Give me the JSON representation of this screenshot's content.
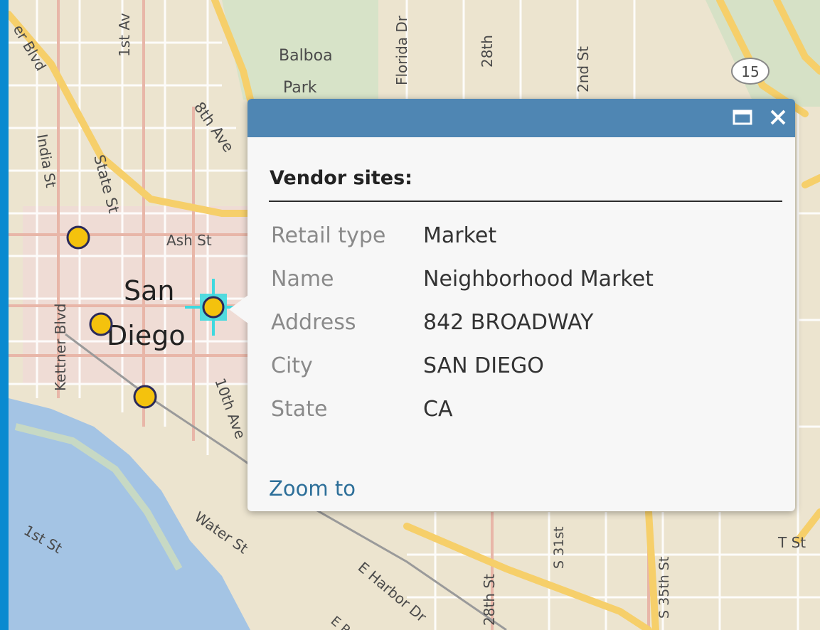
{
  "colors": {
    "frame_blue": "#0a8ad0",
    "header_blue": "#4f86b3",
    "marker_fill": "#f4c20d",
    "selection_cyan": "#3fd9df"
  },
  "popup": {
    "title": "Vendor sites:",
    "maximize_icon": "maximize-icon",
    "close_icon": "close-icon",
    "fields": [
      {
        "label": "Retail type",
        "value": "Market"
      },
      {
        "label": "Name",
        "value": "Neighborhood Market"
      },
      {
        "label": "Address",
        "value": "842 BROADWAY"
      },
      {
        "label": "City",
        "value": "SAN DIEGO"
      },
      {
        "label": "State",
        "value": "CA"
      }
    ],
    "zoom_link": "Zoom to"
  },
  "map": {
    "labels": {
      "city_line1": "San",
      "city_line2": "Diego",
      "balboa_line1": "Balboa",
      "balboa_line2": "Park",
      "eighth_ave": "8th Ave",
      "state_st": "State St",
      "india_st": "India St",
      "first_ave": "1st Av",
      "florida_dr": "Florida Dr",
      "twenty_eighth_top": "28th",
      "second_st": "2nd St",
      "ash_st": "Ash St",
      "kettner_blvd": "Kettner Blvd",
      "tenth_ave": "10th Ave",
      "first_st": "1st St",
      "water_st": "Water St",
      "harbor_dr": "E Harbor Dr",
      "twenty_eighth_bottom": "28th St",
      "s_31st": "S 31st",
      "s_35th": "S 35th St",
      "t_st": "T St",
      "er": "E R",
      "blvd_tl": "er Blvd",
      "highway_shield": "15"
    },
    "markers": 4
  }
}
